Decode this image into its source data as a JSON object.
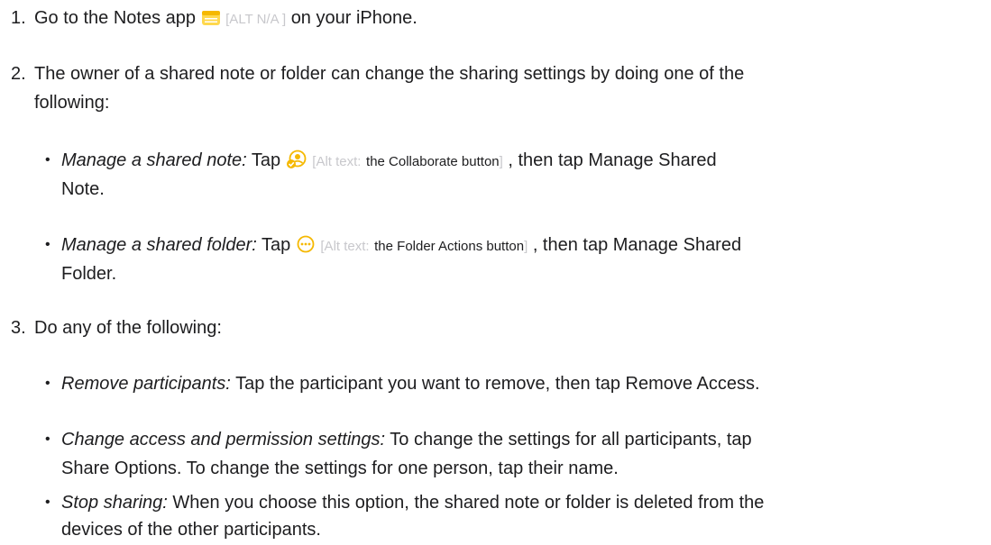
{
  "steps": [
    {
      "number": "1.",
      "text_before": "Go to the Notes app",
      "icon": "notes-app-icon",
      "alt_text": "[ALT N/A ]",
      "text_after": "on your iPhone."
    },
    {
      "number": "2.",
      "line1": "The owner of a shared note or folder can change the sharing settings by doing one of the",
      "line2": "following:",
      "bullets": [
        {
          "label": "Manage a shared note:",
          "tap": "Tap",
          "icon": "collaborate-icon",
          "alt_prefix": "[Alt text:",
          "alt_value": "the Collaborate button",
          "alt_suffix": "]",
          "after": ", then tap Manage Shared",
          "line2": "Note."
        },
        {
          "label": "Manage a shared folder:",
          "tap": "Tap",
          "icon": "folder-actions-icon",
          "alt_prefix": "[Alt text:",
          "alt_value": "the Folder Actions button",
          "alt_suffix": "]",
          "after": ", then tap Manage Shared",
          "line2": "Folder."
        }
      ]
    },
    {
      "number": "3.",
      "text": "Do any of the following:",
      "bullets": [
        {
          "label": "Remove participants:",
          "line1": "Tap the participant you want to remove, then tap Remove Access."
        },
        {
          "label": "Change access and permission settings:",
          "line1": "To change the settings for all participants, tap",
          "line2": "Share Options. To change the settings for one person, tap their name."
        },
        {
          "label": "Stop sharing:",
          "line1": "When you choose this option, the shared note or folder is deleted from the",
          "line2": "devices of the other participants."
        }
      ]
    }
  ],
  "colors": {
    "text": "#1d1d1f",
    "alt_text": "#c8c8cc",
    "accent": "#f5b800"
  }
}
